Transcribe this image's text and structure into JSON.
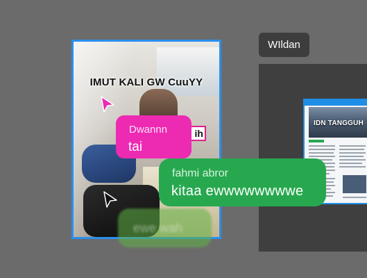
{
  "participant": {
    "name": "WIldan"
  },
  "document": {
    "headline": "IDN TANGGUH"
  },
  "photo": {
    "caption": "IMUT KALI GW CuuYY",
    "badge_text": "ih"
  },
  "messages": [
    {
      "author": "Dwannn",
      "text": "tai",
      "color": "#ec2ab2"
    },
    {
      "author": "fahmi abror",
      "text": "kitaa ewwwwwwwwe",
      "color": "#27a84f"
    },
    {
      "author": "",
      "text": "ewe wah",
      "color": "#60b446"
    }
  ],
  "colors": {
    "background": "#6b6b6b",
    "card_border": "#2a8ff0",
    "pink_pointer": "#ec2ab2"
  }
}
